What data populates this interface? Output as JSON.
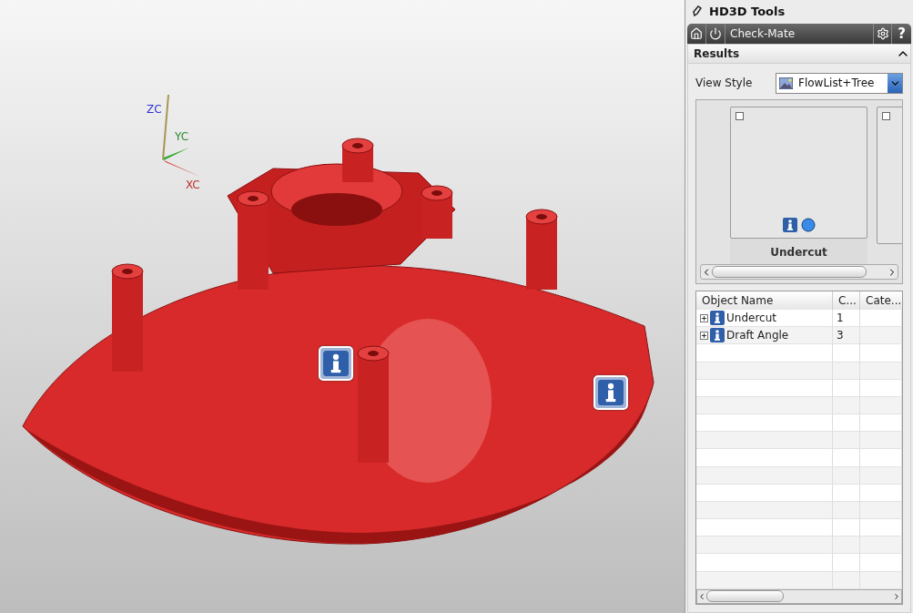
{
  "viewport": {
    "axes": [
      {
        "kind": "z",
        "label": "ZC"
      },
      {
        "kind": "y",
        "label": "YC"
      },
      {
        "kind": "x",
        "label": "XC"
      }
    ]
  },
  "panel": {
    "title": "HD3D Tools",
    "toolbar": {
      "title": "Check-Mate",
      "help": "?"
    },
    "section": {
      "title": "Results",
      "expanded": true
    },
    "view_style": {
      "label": "View Style",
      "value": "FlowList+Tree"
    },
    "flow_cards": [
      {
        "kind": "result",
        "label": "Undercut"
      },
      {
        "kind": "blank"
      }
    ],
    "table": {
      "columns": [
        "Object Name",
        "C...",
        "Cate..."
      ],
      "rows": [
        {
          "name": "Undercut",
          "count": "1",
          "expanded": false
        },
        {
          "name": "Draft Angle",
          "count": "3",
          "expanded": false
        }
      ]
    }
  }
}
